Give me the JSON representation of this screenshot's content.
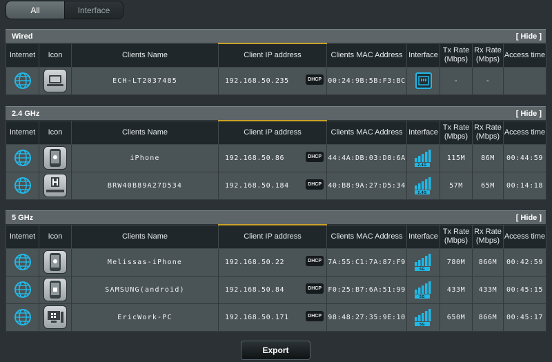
{
  "tabs": {
    "all": "All",
    "interface": "Interface"
  },
  "hide_label": "[ Hide ]",
  "columns": {
    "internet": "Internet",
    "icon": "Icon",
    "name": "Clients Name",
    "ip": "Client IP address",
    "mac": "Clients MAC Address",
    "interface": "Interface",
    "tx": "Tx Rate\n(Mbps)",
    "rx": "Rx Rate\n(Mbps)",
    "access": "Access time"
  },
  "dhcp_label": "DHCP",
  "sections": [
    {
      "title": "Wired",
      "clients": [
        {
          "name": "ECH-LT2037485",
          "ip": "192.168.50.235",
          "mac": "00:24:9B:5B:F3:BC",
          "tx": "-",
          "rx": "-",
          "access": "",
          "device_icon": "laptop-icon",
          "iface": "wired"
        }
      ]
    },
    {
      "title": "2.4 GHz",
      "clients": [
        {
          "name": "iPhone",
          "ip": "192.168.50.86",
          "mac": "44:4A:DB:03:D8:6A",
          "tx": "115M",
          "rx": "86M",
          "access": "00:44:59",
          "device_icon": "apple-phone-icon",
          "band": "2.4G"
        },
        {
          "name": "BRW40B89A27D534",
          "ip": "192.168.50.184",
          "mac": "40:B8:9A:27:D5:34",
          "tx": "57M",
          "rx": "65M",
          "access": "00:14:18",
          "device_icon": "foxconn-icon",
          "band": "2.4G"
        }
      ]
    },
    {
      "title": "5 GHz",
      "clients": [
        {
          "name": "Melissas-iPhone",
          "ip": "192.168.50.22",
          "mac": "7A:55:C1:7A:87:F9",
          "tx": "780M",
          "rx": "866M",
          "access": "00:42:59",
          "device_icon": "apple-phone-icon",
          "band": "5G"
        },
        {
          "name": "SAMSUNG(android)",
          "ip": "192.168.50.84",
          "mac": "F0:25:B7:6A:51:99",
          "tx": "433M",
          "rx": "433M",
          "access": "00:45:15",
          "device_icon": "android-phone-icon",
          "band": "5G"
        },
        {
          "name": "EricWork-PC",
          "ip": "192.168.50.171",
          "mac": "98:48:27:35:9E:10",
          "tx": "650M",
          "rx": "866M",
          "access": "00:45:17",
          "device_icon": "windows-pc-icon",
          "band": "5G"
        }
      ]
    }
  ],
  "export_label": "Export",
  "colors": {
    "accent": "#22b8e6",
    "ip_header_accent": "#c9a227",
    "background": "#2b3134"
  }
}
